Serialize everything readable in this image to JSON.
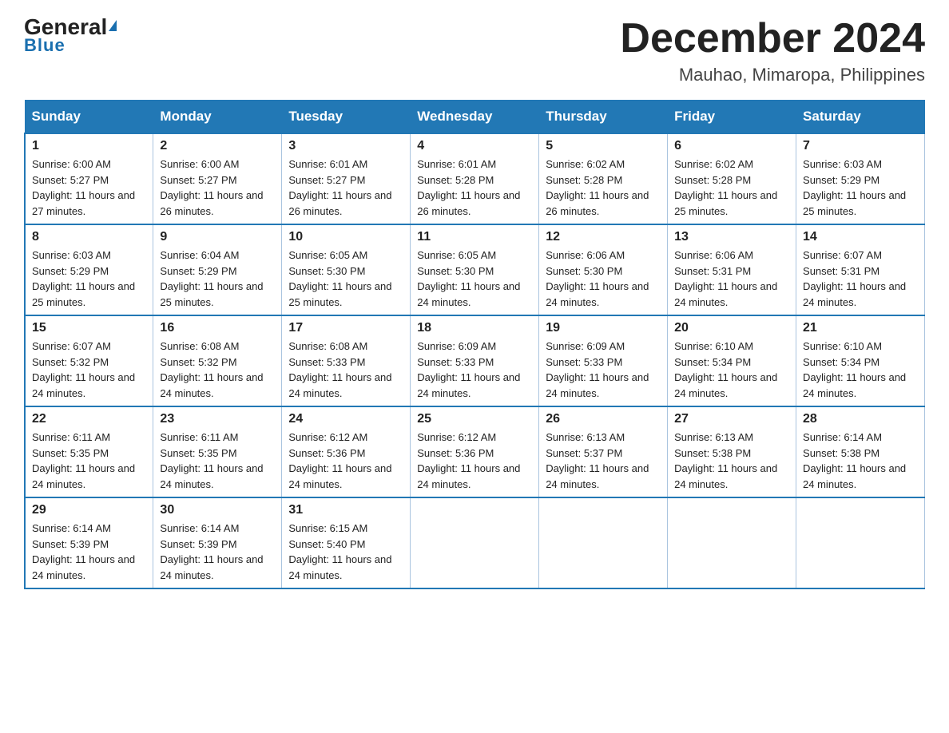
{
  "logo": {
    "part1": "General",
    "part2": "Blue"
  },
  "title": "December 2024",
  "location": "Mauhao, Mimaropa, Philippines",
  "days_of_week": [
    "Sunday",
    "Monday",
    "Tuesday",
    "Wednesday",
    "Thursday",
    "Friday",
    "Saturday"
  ],
  "weeks": [
    [
      {
        "num": "1",
        "sunrise": "6:00 AM",
        "sunset": "5:27 PM",
        "daylight": "11 hours and 27 minutes."
      },
      {
        "num": "2",
        "sunrise": "6:00 AM",
        "sunset": "5:27 PM",
        "daylight": "11 hours and 26 minutes."
      },
      {
        "num": "3",
        "sunrise": "6:01 AM",
        "sunset": "5:27 PM",
        "daylight": "11 hours and 26 minutes."
      },
      {
        "num": "4",
        "sunrise": "6:01 AM",
        "sunset": "5:28 PM",
        "daylight": "11 hours and 26 minutes."
      },
      {
        "num": "5",
        "sunrise": "6:02 AM",
        "sunset": "5:28 PM",
        "daylight": "11 hours and 26 minutes."
      },
      {
        "num": "6",
        "sunrise": "6:02 AM",
        "sunset": "5:28 PM",
        "daylight": "11 hours and 25 minutes."
      },
      {
        "num": "7",
        "sunrise": "6:03 AM",
        "sunset": "5:29 PM",
        "daylight": "11 hours and 25 minutes."
      }
    ],
    [
      {
        "num": "8",
        "sunrise": "6:03 AM",
        "sunset": "5:29 PM",
        "daylight": "11 hours and 25 minutes."
      },
      {
        "num": "9",
        "sunrise": "6:04 AM",
        "sunset": "5:29 PM",
        "daylight": "11 hours and 25 minutes."
      },
      {
        "num": "10",
        "sunrise": "6:05 AM",
        "sunset": "5:30 PM",
        "daylight": "11 hours and 25 minutes."
      },
      {
        "num": "11",
        "sunrise": "6:05 AM",
        "sunset": "5:30 PM",
        "daylight": "11 hours and 24 minutes."
      },
      {
        "num": "12",
        "sunrise": "6:06 AM",
        "sunset": "5:30 PM",
        "daylight": "11 hours and 24 minutes."
      },
      {
        "num": "13",
        "sunrise": "6:06 AM",
        "sunset": "5:31 PM",
        "daylight": "11 hours and 24 minutes."
      },
      {
        "num": "14",
        "sunrise": "6:07 AM",
        "sunset": "5:31 PM",
        "daylight": "11 hours and 24 minutes."
      }
    ],
    [
      {
        "num": "15",
        "sunrise": "6:07 AM",
        "sunset": "5:32 PM",
        "daylight": "11 hours and 24 minutes."
      },
      {
        "num": "16",
        "sunrise": "6:08 AM",
        "sunset": "5:32 PM",
        "daylight": "11 hours and 24 minutes."
      },
      {
        "num": "17",
        "sunrise": "6:08 AM",
        "sunset": "5:33 PM",
        "daylight": "11 hours and 24 minutes."
      },
      {
        "num": "18",
        "sunrise": "6:09 AM",
        "sunset": "5:33 PM",
        "daylight": "11 hours and 24 minutes."
      },
      {
        "num": "19",
        "sunrise": "6:09 AM",
        "sunset": "5:33 PM",
        "daylight": "11 hours and 24 minutes."
      },
      {
        "num": "20",
        "sunrise": "6:10 AM",
        "sunset": "5:34 PM",
        "daylight": "11 hours and 24 minutes."
      },
      {
        "num": "21",
        "sunrise": "6:10 AM",
        "sunset": "5:34 PM",
        "daylight": "11 hours and 24 minutes."
      }
    ],
    [
      {
        "num": "22",
        "sunrise": "6:11 AM",
        "sunset": "5:35 PM",
        "daylight": "11 hours and 24 minutes."
      },
      {
        "num": "23",
        "sunrise": "6:11 AM",
        "sunset": "5:35 PM",
        "daylight": "11 hours and 24 minutes."
      },
      {
        "num": "24",
        "sunrise": "6:12 AM",
        "sunset": "5:36 PM",
        "daylight": "11 hours and 24 minutes."
      },
      {
        "num": "25",
        "sunrise": "6:12 AM",
        "sunset": "5:36 PM",
        "daylight": "11 hours and 24 minutes."
      },
      {
        "num": "26",
        "sunrise": "6:13 AM",
        "sunset": "5:37 PM",
        "daylight": "11 hours and 24 minutes."
      },
      {
        "num": "27",
        "sunrise": "6:13 AM",
        "sunset": "5:38 PM",
        "daylight": "11 hours and 24 minutes."
      },
      {
        "num": "28",
        "sunrise": "6:14 AM",
        "sunset": "5:38 PM",
        "daylight": "11 hours and 24 minutes."
      }
    ],
    [
      {
        "num": "29",
        "sunrise": "6:14 AM",
        "sunset": "5:39 PM",
        "daylight": "11 hours and 24 minutes."
      },
      {
        "num": "30",
        "sunrise": "6:14 AM",
        "sunset": "5:39 PM",
        "daylight": "11 hours and 24 minutes."
      },
      {
        "num": "31",
        "sunrise": "6:15 AM",
        "sunset": "5:40 PM",
        "daylight": "11 hours and 24 minutes."
      },
      null,
      null,
      null,
      null
    ]
  ]
}
